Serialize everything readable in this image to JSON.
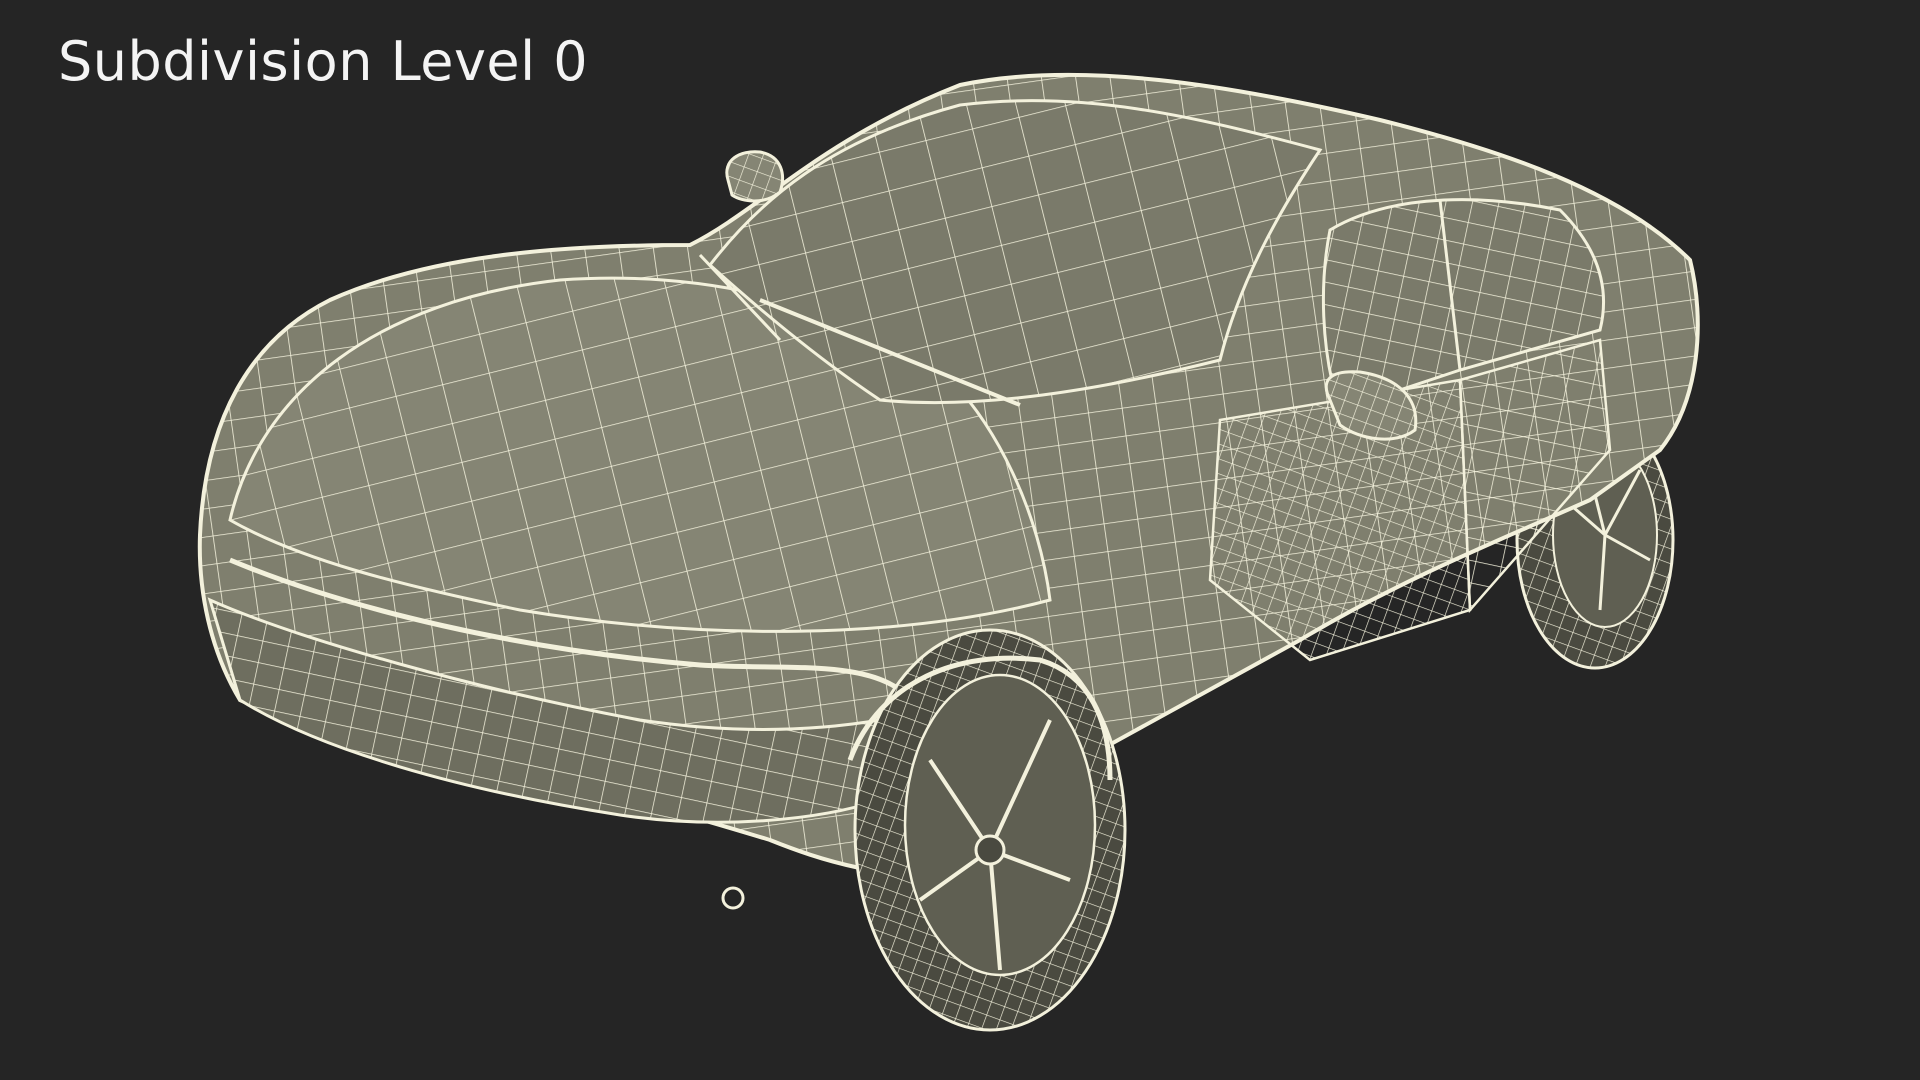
{
  "caption": "Subdivision Level 0",
  "subject": "car-wireframe",
  "colors": {
    "background": "#252525",
    "surface": "#7f7f6e",
    "surface_dark": "#5f5f52",
    "wire": "#f3f1dc",
    "tire": "#4a4a40"
  }
}
